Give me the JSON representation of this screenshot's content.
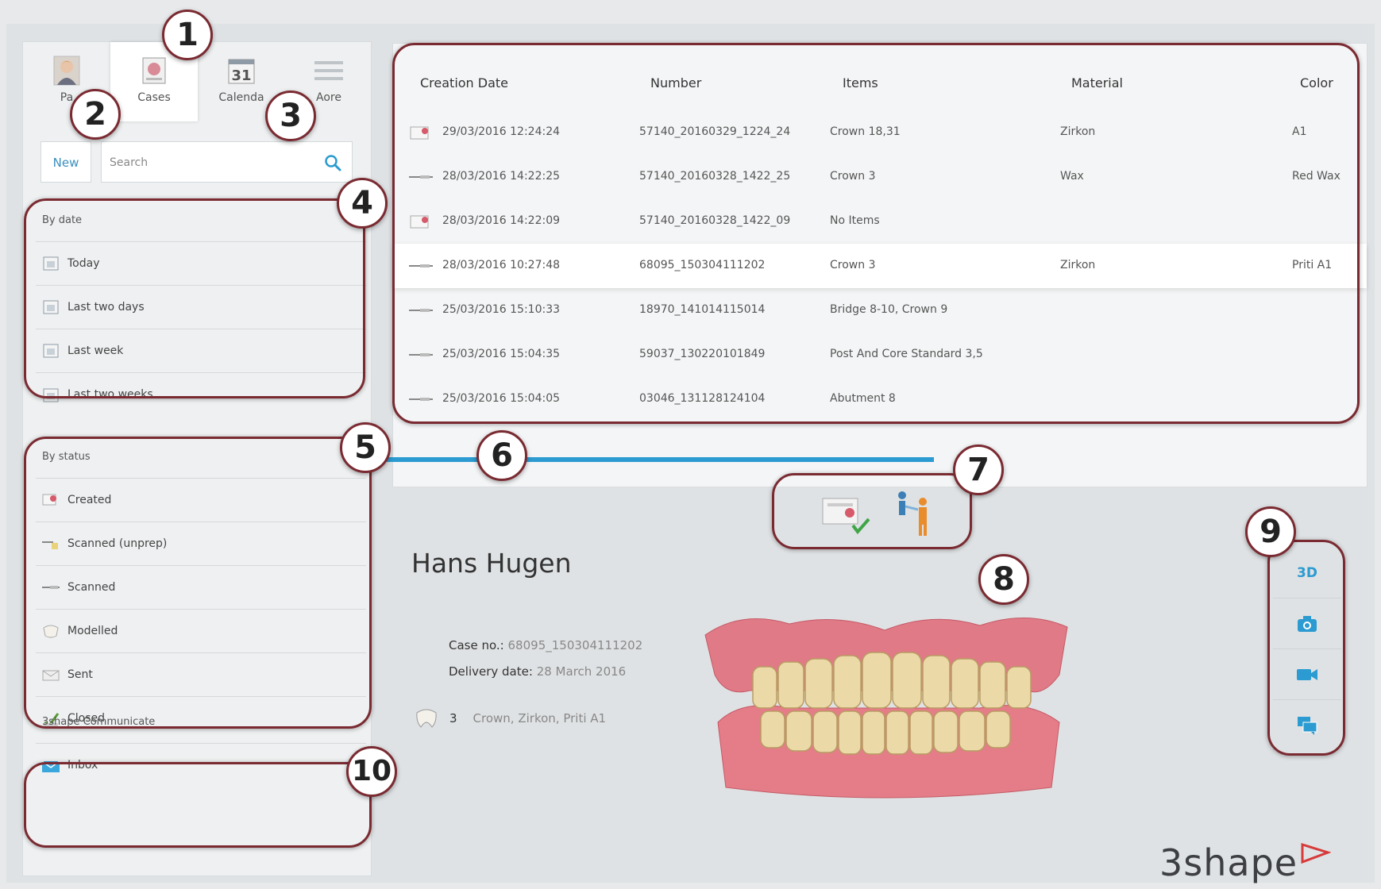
{
  "nav": {
    "tabs": [
      {
        "label": "Pa",
        "icon": "patient-photo-icon"
      },
      {
        "label": "Cases",
        "icon": "cases-icon"
      },
      {
        "label": "Calenda",
        "icon": "calendar-icon",
        "icon_text": "31"
      },
      {
        "label": "Aore",
        "icon": "more-icon"
      }
    ],
    "active": "Cases"
  },
  "toolbar": {
    "new_label": "New",
    "search_placeholder": "Search"
  },
  "by_date": {
    "title": "By date",
    "items": [
      {
        "label": "Today",
        "icon": "calendar-icon"
      },
      {
        "label": "Last two days",
        "icon": "calendar-icon"
      },
      {
        "label": "Last week",
        "icon": "calendar-icon"
      },
      {
        "label": "Last two weeks",
        "icon": "calendar-icon"
      }
    ]
  },
  "by_status": {
    "title": "By status",
    "items": [
      {
        "label": "Created",
        "icon": "created-icon"
      },
      {
        "label": "Scanned (unprep)",
        "icon": "scanned-unprep-icon"
      },
      {
        "label": "Scanned",
        "icon": "scanner-icon"
      },
      {
        "label": "Modelled",
        "icon": "modelled-icon"
      },
      {
        "label": "Sent",
        "icon": "sent-icon"
      },
      {
        "label": "Closed",
        "icon": "closed-icon"
      }
    ]
  },
  "communicate": {
    "title": "3shape Communicate",
    "items": [
      {
        "label": "Inbox",
        "icon": "envelope-icon"
      }
    ]
  },
  "table": {
    "headers": [
      "Creation Date",
      "Number",
      "Items",
      "Material",
      "Color"
    ],
    "rows": [
      {
        "date": "29/03/2016 12:24:24",
        "number": "57140_20160329_1224_24",
        "items": "Crown 18,31",
        "material": "Zirkon",
        "color": "A1",
        "icon": "created-icon",
        "selected": false
      },
      {
        "date": "28/03/2016 14:22:25",
        "number": "57140_20160328_1422_25",
        "items": "Crown 3",
        "material": "Wax",
        "color": "Red Wax",
        "icon": "scanner-icon",
        "selected": false
      },
      {
        "date": "28/03/2016 14:22:09",
        "number": "57140_20160328_1422_09",
        "items": "No Items",
        "material": "",
        "color": "",
        "icon": "created-icon",
        "selected": false
      },
      {
        "date": "28/03/2016 10:27:48",
        "number": "68095_150304111202",
        "items": "Crown 3",
        "material": "Zirkon",
        "color": "Priti A1",
        "icon": "scanner-icon",
        "selected": true
      },
      {
        "date": "25/03/2016 15:10:33",
        "number": "18970_141014115014",
        "items": "Bridge 8-10, Crown 9",
        "material": "",
        "color": "",
        "icon": "scanner-icon",
        "selected": false
      },
      {
        "date": "25/03/2016 15:04:35",
        "number": "59037_130220101849",
        "items": "Post And Core Standard 3,5",
        "material": "",
        "color": "",
        "icon": "scanner-icon",
        "selected": false
      },
      {
        "date": "25/03/2016 15:04:05",
        "number": "03046_131128124104",
        "items": "Abutment 8",
        "material": "",
        "color": "",
        "icon": "scanner-icon",
        "selected": false
      }
    ]
  },
  "actions": [
    {
      "name": "approve-case",
      "icon": "approve-case-icon"
    },
    {
      "name": "assign-case",
      "icon": "assign-people-icon"
    }
  ],
  "detail": {
    "patient_name": "Hans Hugen",
    "case_no_label": "Case no.:",
    "case_no": "68095_150304111202",
    "delivery_label": "Delivery date:",
    "delivery_date": "28 March 2016",
    "tooth_number": "3",
    "tooth_desc": "Crown, Zirkon, Priti A1"
  },
  "view_modes": [
    {
      "name": "3d",
      "label": "3D"
    },
    {
      "name": "photo",
      "icon": "camera-icon"
    },
    {
      "name": "video",
      "icon": "video-camera-icon"
    },
    {
      "name": "chat",
      "icon": "chat-icon"
    }
  ],
  "logo": "3shape",
  "callouts": [
    "1",
    "2",
    "3",
    "4",
    "5",
    "6",
    "7",
    "8",
    "9",
    "10"
  ],
  "colors": {
    "accent": "#2b9bd1",
    "callout_border": "#7a2a31"
  }
}
